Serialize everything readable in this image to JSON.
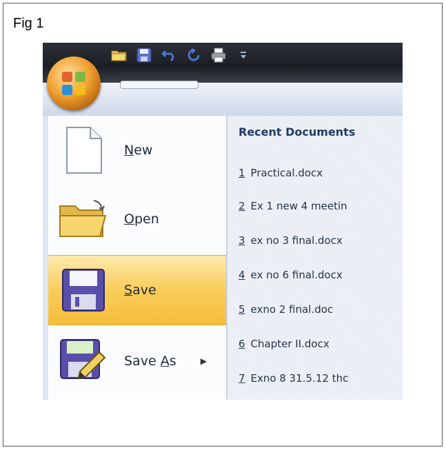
{
  "figure": {
    "label": "Fig 1"
  },
  "menu": {
    "items": [
      {
        "key": "new",
        "prefix": "",
        "mnemonic": "N",
        "suffix": "ew",
        "icon": "new-document-icon",
        "selected": false
      },
      {
        "key": "open",
        "prefix": "",
        "mnemonic": "O",
        "suffix": "pen",
        "icon": "open-folder-icon",
        "selected": false
      },
      {
        "key": "save",
        "prefix": "",
        "mnemonic": "S",
        "suffix": "ave",
        "icon": "save-disk-icon",
        "selected": true
      },
      {
        "key": "save-as",
        "prefix": "Save ",
        "mnemonic": "A",
        "suffix": "s",
        "icon": "save-as-icon",
        "selected": false,
        "has_submenu": true
      }
    ]
  },
  "recent": {
    "title": "Recent Documents",
    "items": [
      {
        "num": "1",
        "name": "Practical.docx"
      },
      {
        "num": "2",
        "name": "Ex 1 new 4 meetin"
      },
      {
        "num": "3",
        "name": "ex no 3 final.docx"
      },
      {
        "num": "4",
        "name": "ex no 6 final.docx"
      },
      {
        "num": "5",
        "name": "exno 2 final.doc"
      },
      {
        "num": "6",
        "name": "Chapter II.docx"
      },
      {
        "num": "7",
        "name": "Exno 8 31.5.12 thc"
      }
    ]
  },
  "quick_access_toolbar": {
    "icons": [
      "open-icon",
      "save-icon",
      "undo-icon",
      "redo-icon",
      "print-icon",
      "customize-dropdown-icon"
    ]
  },
  "colors": {
    "selected_gradient": "#f9cd5a",
    "office_button": "#f0a030",
    "recent_title": "#1f3b63"
  }
}
